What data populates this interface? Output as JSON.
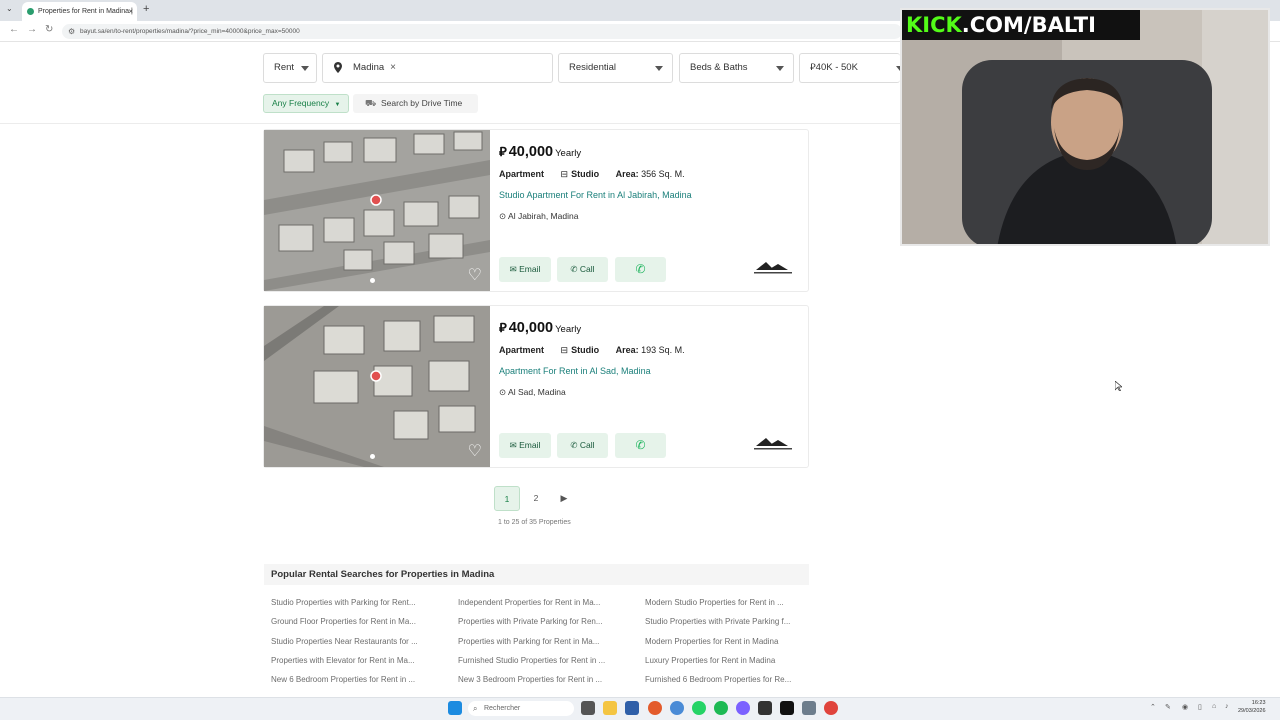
{
  "browser": {
    "tab_title": "Properties for Rent in Madina |",
    "url": "bayut.sa/en/to-rent/properties/madina/?price_min=40000&price_max=50000",
    "new_tab": "+",
    "tab_close": "×"
  },
  "filters": {
    "purpose": "Rent",
    "location_chip": "Madina",
    "chip_remove": "×",
    "category": "Residential",
    "beds_baths": "Beds & Baths",
    "price": "40K - 50K",
    "frequency": "Any Frequency",
    "drive_time": "Search by Drive Time"
  },
  "currency_symbol": "⃁",
  "listings": [
    {
      "price": "40,000",
      "period": "Yearly",
      "type": "Apartment",
      "beds": "Studio",
      "area_label": "Area:",
      "area_value": "356 Sq. M.",
      "title": "Studio Apartment For Rent in Al Jabirah, Madina",
      "location": "Al Jabirah, Madina",
      "email_label": "Email",
      "call_label": "Call"
    },
    {
      "price": "40,000",
      "period": "Yearly",
      "type": "Apartment",
      "beds": "Studio",
      "area_label": "Area:",
      "area_value": "193 Sq. M.",
      "title": "Apartment For Rent in Al Sad, Madina",
      "location": "Al Sad, Madina",
      "email_label": "Email",
      "call_label": "Call"
    }
  ],
  "pagination": {
    "page1": "1",
    "page2": "2",
    "count": "1 to 25 of 35 Properties"
  },
  "popular": {
    "heading": "Popular Rental Searches for Properties in Madina",
    "col1": [
      "Studio Properties with Parking for Rent...",
      "Ground Floor Properties for Rent in Ma...",
      "Studio Properties Near Restaurants for ...",
      "Properties with Elevator for Rent in Ma...",
      "New 6 Bedroom Properties for Rent in ..."
    ],
    "col2": [
      "Independent Properties for Rent in Ma...",
      "Properties with Private Parking for Ren...",
      "Properties with Parking for Rent in Ma...",
      "Furnished Studio Properties for Rent in ...",
      "New 3 Bedroom Properties for Rent in ..."
    ],
    "col3": [
      "Modern Studio Properties for Rent in ...",
      "Studio Properties with Private Parking f...",
      "Modern Properties for Rent in Madina",
      "Luxury Properties for Rent in Madina",
      "Furnished 6 Bedroom Properties for Re..."
    ]
  },
  "overlay": {
    "kick_green": "KICK",
    "kick_rest": ".COM/BALTI"
  },
  "taskbar": {
    "search_placeholder": "Rechercher",
    "time": "16:23",
    "date": "29/03/2026"
  },
  "colors": {
    "accent_green": "#1a8048",
    "link_teal": "#1a7f7a",
    "kick_green": "#53fc18"
  }
}
